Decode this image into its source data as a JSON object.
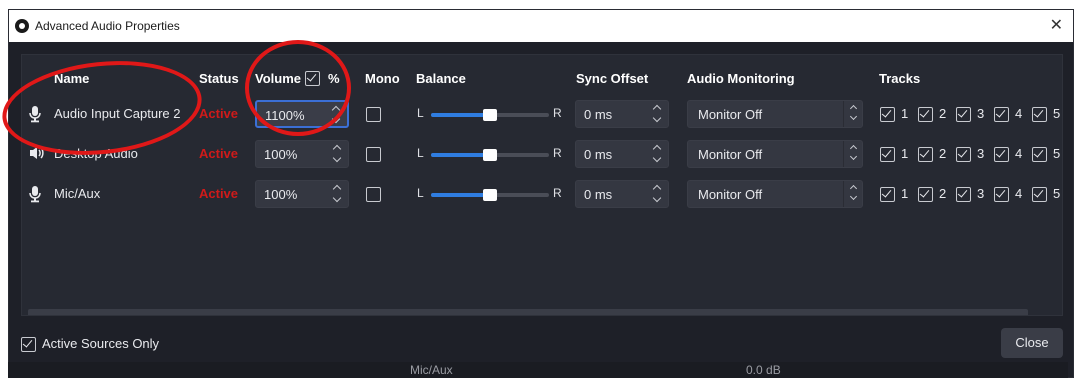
{
  "window": {
    "title": "Advanced Audio Properties",
    "close_glyph": "✕"
  },
  "headers": {
    "name": "Name",
    "status": "Status",
    "volume": "Volume",
    "volume_percent": "%",
    "mono": "Mono",
    "balance": "Balance",
    "sync_offset": "Sync Offset",
    "audio_monitoring": "Audio Monitoring",
    "tracks": "Tracks"
  },
  "rows": [
    {
      "icon": "microphone-icon",
      "name": "Audio Input Capture 2",
      "status": "Active",
      "volume": "1100%",
      "mono": false,
      "balance_fraction": 0.5,
      "balance_L": "L",
      "balance_R": "R",
      "sync_offset": "0 ms",
      "monitoring": "Monitor Off",
      "tracks": [
        "1",
        "2",
        "3",
        "4",
        "5"
      ]
    },
    {
      "icon": "speaker-icon",
      "name": "Desktop Audio",
      "status": "Active",
      "volume": "100%",
      "mono": false,
      "balance_fraction": 0.5,
      "balance_L": "L",
      "balance_R": "R",
      "sync_offset": "0 ms",
      "monitoring": "Monitor Off",
      "tracks": [
        "1",
        "2",
        "3",
        "4",
        "5"
      ]
    },
    {
      "icon": "microphone-icon",
      "name": "Mic/Aux",
      "status": "Active",
      "volume": "100%",
      "mono": false,
      "balance_fraction": 0.5,
      "balance_L": "L",
      "balance_R": "R",
      "sync_offset": "0 ms",
      "monitoring": "Monitor Off",
      "tracks": [
        "1",
        "2",
        "3",
        "4",
        "5"
      ]
    }
  ],
  "footer": {
    "active_sources_only": "Active Sources Only",
    "close_label": "Close"
  },
  "background": {
    "mic_label": "Mic/Aux",
    "db_label": "0.0 dB"
  },
  "colors": {
    "status_active": "#d01a1a",
    "slider_fill": "#2f7de1",
    "focus_border": "#3b6fd6",
    "annotation": "#e01818"
  }
}
